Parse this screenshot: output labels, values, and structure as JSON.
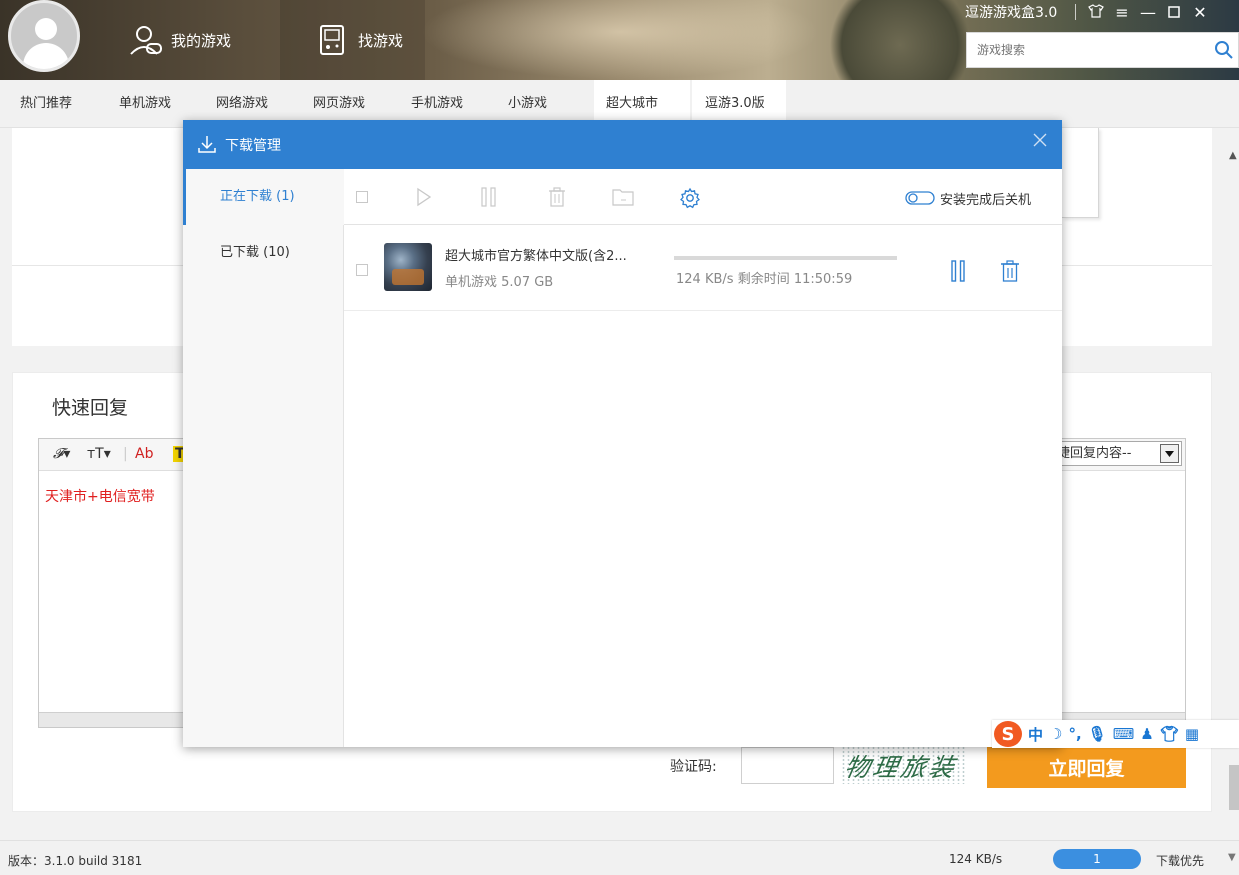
{
  "header": {
    "nav_my_games": "我的游戏",
    "nav_find_games": "找游戏",
    "brand": "逗游游戏盒3.0",
    "search_placeholder": "游戏搜索"
  },
  "categories": [
    "热门推荐",
    "单机游戏",
    "网络游戏",
    "网页游戏",
    "手机游戏",
    "小游戏",
    "超大城市",
    "逗游3.0版"
  ],
  "reply": {
    "title": "快速回复",
    "toolbar": {
      "font": "𝓕▾",
      "size": "ᴛT▾",
      "color": "Ab",
      "highlight": "T"
    },
    "content": "天津市+电信宽带",
    "quick_select": "捷回复内容--",
    "captcha_label": "验证码:",
    "captcha_text": "物理旅装",
    "submit": "立即回复"
  },
  "ime": {
    "lang": "中"
  },
  "status": {
    "version": "版本：3.1.0 build 3181",
    "speed": "124 KB/s",
    "count": "1",
    "priority": "下载优先"
  },
  "download_dialog": {
    "title": "下载管理",
    "tabs": {
      "downloading": "正在下载 (1)",
      "downloaded": "已下载 (10)"
    },
    "shutdown_label": "安装完成后关机",
    "task": {
      "name": "超大城市官方繁体中文版(含2...",
      "category": "单机游戏",
      "size": "5.07 GB",
      "speed": "124 KB/s",
      "remaining_label": "剩余时间",
      "remaining": "11:50:59",
      "progress": 0.0
    }
  },
  "colors": {
    "accent": "#2f80d1",
    "reply_button": "#f39a1e",
    "reply_text": "#e02020"
  }
}
